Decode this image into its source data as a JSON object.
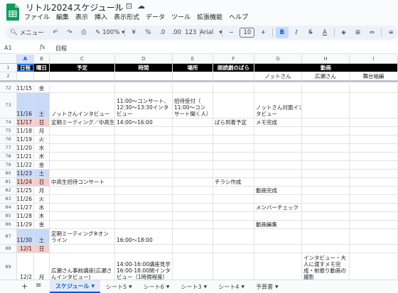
{
  "app": {
    "doc_title": "リトル2024スケジュール",
    "menu": [
      "ファイル",
      "編集",
      "表示",
      "挿入",
      "表示形式",
      "データ",
      "ツール",
      "拡張機能",
      "ヘルプ"
    ]
  },
  "toolbar": {
    "search_label": "メニュー",
    "zoom": "100%",
    "currency": "¥",
    "percent": "%",
    "decimal_decrease": ".0",
    "decimal_increase": ".00",
    "number_format": "123",
    "font": "Arial",
    "font_size": "10",
    "bold": "B",
    "italic": "I",
    "strike": "S",
    "text_color": "A"
  },
  "formula_bar": {
    "cell_ref": "A1",
    "fx": "fx",
    "content": "日程"
  },
  "columns": [
    "A",
    "B",
    "C",
    "D",
    "E",
    "F",
    "G",
    "H",
    "I"
  ],
  "header_row1": {
    "rownum": "1",
    "a": "日程",
    "b": "曜日",
    "c": "予定",
    "d": "時間",
    "e": "場所",
    "f": "朗読劇のばら",
    "h": "動画"
  },
  "header_row2": {
    "rownum": "2",
    "g": "ノットさん",
    "h": "広瀬さん",
    "i": "舞台袖編"
  },
  "rows": [
    {
      "n": "72",
      "a": "11/15",
      "b": "金",
      "c": "",
      "d": "",
      "e": "",
      "f": "",
      "g": "",
      "h": "",
      "i": ""
    },
    {
      "n": "73",
      "a": "11/16",
      "b": "土",
      "c": "ノットさんインタビュー",
      "d": "11:00～コンサート、\n12:30～13:30インタ\nビュー",
      "e": "招待受付（\n11:00～コン\nサート聞く人）",
      "f": "",
      "g": "ノットさん対面イン\nタビュー",
      "h": "",
      "i": ""
    },
    {
      "n": "74",
      "a": "11/17",
      "b": "日",
      "c": "定期ミーティング／中高生",
      "d": "14:00～16:00",
      "e": "",
      "f": "ばら到着予定",
      "g": "メモ完成",
      "h": "",
      "i": ""
    },
    {
      "n": "75",
      "a": "11/18",
      "b": "月",
      "c": "",
      "d": "",
      "e": "",
      "f": "",
      "g": "",
      "h": "",
      "i": ""
    },
    {
      "n": "76",
      "a": "11/19",
      "b": "火",
      "c": "",
      "d": "",
      "e": "",
      "f": "",
      "g": "",
      "h": "",
      "i": ""
    },
    {
      "n": "77",
      "a": "11/20",
      "b": "水",
      "c": "",
      "d": "",
      "e": "",
      "f": "",
      "g": "",
      "h": "",
      "i": ""
    },
    {
      "n": "78",
      "a": "11/21",
      "b": "木",
      "c": "",
      "d": "",
      "e": "",
      "f": "",
      "g": "",
      "h": "",
      "i": ""
    },
    {
      "n": "79",
      "a": "11/22",
      "b": "金",
      "c": "",
      "d": "",
      "e": "",
      "f": "",
      "g": "",
      "h": "",
      "i": ""
    },
    {
      "n": "80",
      "a": "11/23",
      "b": "土",
      "c": "",
      "d": "",
      "e": "",
      "f": "",
      "g": "",
      "h": "",
      "i": ""
    },
    {
      "n": "81",
      "a": "11/24",
      "b": "日",
      "c": "中高生招待コンサート",
      "d": "",
      "e": "",
      "f": "チラシ作成",
      "g": "",
      "h": "",
      "i": ""
    },
    {
      "n": "82",
      "a": "11/25",
      "b": "月",
      "c": "",
      "d": "",
      "e": "",
      "f": "",
      "g": "動画完成",
      "h": "",
      "i": ""
    },
    {
      "n": "83",
      "a": "11/26",
      "b": "火",
      "c": "",
      "d": "",
      "e": "",
      "f": "",
      "g": "",
      "h": "",
      "i": ""
    },
    {
      "n": "84",
      "a": "11/27",
      "b": "水",
      "c": "",
      "d": "",
      "e": "",
      "f": "",
      "g": "メンバーチェック",
      "h": "",
      "i": ""
    },
    {
      "n": "85",
      "a": "11/28",
      "b": "木",
      "c": "",
      "d": "",
      "e": "",
      "f": "",
      "g": "",
      "h": "",
      "i": ""
    },
    {
      "n": "86",
      "a": "11/29",
      "b": "金",
      "c": "",
      "d": "",
      "e": "",
      "f": "",
      "g": "動画編集",
      "h": "",
      "i": ""
    },
    {
      "n": "87",
      "a": "11/30",
      "b": "土",
      "c": "定期ミーティング※オン\nライン",
      "d": "16:00～18:00",
      "e": "",
      "f": "",
      "g": "",
      "h": "",
      "i": ""
    },
    {
      "n": "88",
      "a": "12/1",
      "b": "日",
      "c": "",
      "d": "",
      "e": "",
      "f": "",
      "g": "",
      "h": "",
      "i": ""
    },
    {
      "n": "89",
      "a": "12/2",
      "b": "月",
      "c": "広瀬さん事前講座(広瀬さ\nんインタビュー)",
      "d": "14:00-16:00講座見学\n16:00-18:00関インタ\nビュー（1時間程度）",
      "e": "",
      "f": "",
      "g": "",
      "h": "インタビュー・大\n人に渡すメモ完\n成・前振り動画の\n撮影",
      "i": ""
    }
  ],
  "sheets": {
    "add": "+",
    "list": "≡",
    "tabs": [
      "スケジュール",
      "シート5",
      "シート6",
      "シート3",
      "シート4",
      "予算書"
    ]
  },
  "colors": {
    "header_bg": "#000000",
    "header_fg": "#ffffff",
    "saturday_bg": "#c9daf8",
    "sunday_bg": "#f4cccc",
    "accent": "#0b57d0",
    "logo": "#0f9d58"
  }
}
